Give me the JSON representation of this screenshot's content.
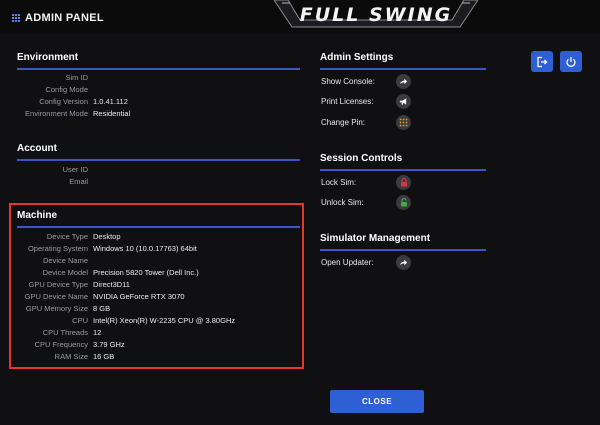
{
  "header": {
    "title": "ADMIN PANEL",
    "logo": "FULL SWING"
  },
  "environment": {
    "title": "Environment",
    "rows": [
      {
        "label": "Sim ID",
        "value": ""
      },
      {
        "label": "Config Mode",
        "value": ""
      },
      {
        "label": "Config Version",
        "value": "1.0.41.112"
      },
      {
        "label": "Environment Mode",
        "value": "Residential"
      }
    ]
  },
  "account": {
    "title": "Account",
    "rows": [
      {
        "label": "User ID",
        "value": ""
      },
      {
        "label": "Email",
        "value": ""
      }
    ]
  },
  "machine": {
    "title": "Machine",
    "rows": [
      {
        "label": "Device Type",
        "value": "Desktop"
      },
      {
        "label": "Operating System",
        "value": "Windows 10  (10.0.17763) 64bit"
      },
      {
        "label": "Device Name",
        "value": ""
      },
      {
        "label": "Device Model",
        "value": "Precision 5820 Tower (Dell Inc.)"
      },
      {
        "label": "GPU Device Type",
        "value": "Direct3D11"
      },
      {
        "label": "GPU Device Name",
        "value": "NVIDIA GeForce RTX 3070"
      },
      {
        "label": "GPU Memory Size",
        "value": "8 GB"
      },
      {
        "label": "CPU",
        "value": "Intel(R) Xeon(R) W-2235 CPU @ 3.80GHz"
      },
      {
        "label": "CPU Threads",
        "value": "12"
      },
      {
        "label": "CPU Frequency",
        "value": "3.79 GHz"
      },
      {
        "label": "RAM Size",
        "value": "16 GB"
      }
    ]
  },
  "admin_settings": {
    "title": "Admin Settings",
    "items": [
      {
        "label": "Show Console:",
        "icon": "share-arrow-icon"
      },
      {
        "label": "Print Licenses:",
        "icon": "megaphone-icon"
      },
      {
        "label": "Change Pin:",
        "icon": "keypad-icon"
      }
    ]
  },
  "session_controls": {
    "title": "Session Controls",
    "items": [
      {
        "label": "Lock Sim:",
        "icon": "lock-icon",
        "color": "#d9363e"
      },
      {
        "label": "Unlock Sim:",
        "icon": "unlock-icon",
        "color": "#3fae49"
      }
    ]
  },
  "simulator_management": {
    "title": "Simulator Management",
    "items": [
      {
        "label": "Open Updater:",
        "icon": "share-arrow-icon"
      }
    ]
  },
  "buttons": {
    "close": "CLOSE",
    "logout_icon": "logout-icon",
    "power_icon": "power-icon"
  },
  "colors": {
    "accent": "#2f5fd4",
    "highlight_border": "#e2382b",
    "rule": "#3a56c9",
    "keypad": "#e0a52a"
  }
}
